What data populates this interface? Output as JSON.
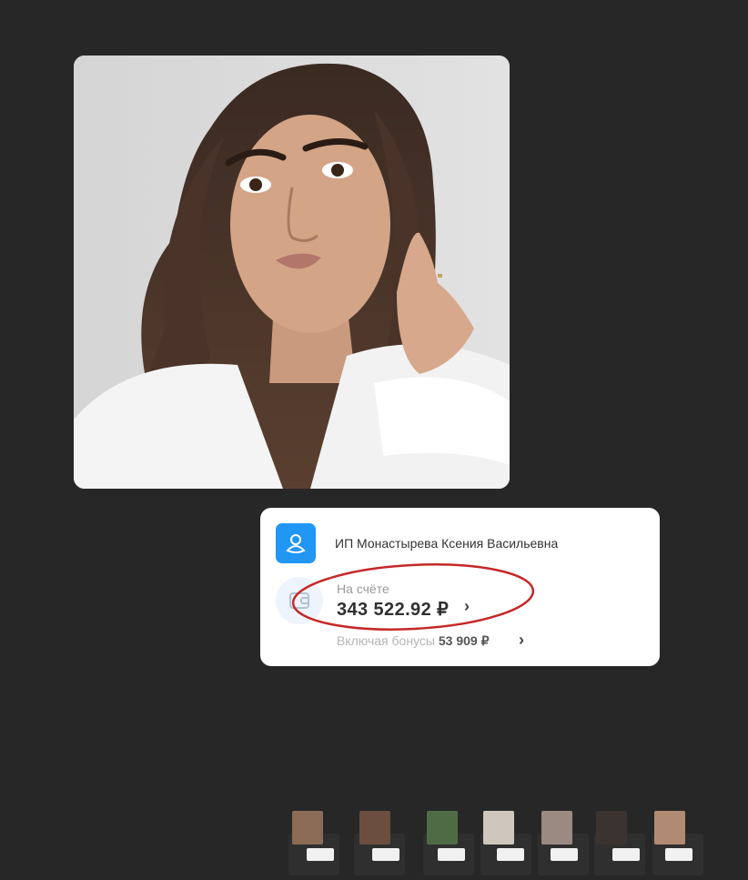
{
  "main_card": {
    "photo_description_icon": "portrait-photo"
  },
  "bank_card": {
    "owner_name": "ИП Монастырева Ксения Васильевна",
    "balance_label": "На счёте",
    "balance_value": "343 522.92 ₽",
    "bonus_prefix": "Включая бонусы",
    "bonus_value": "53 909 ₽",
    "chevron": "›",
    "colors": {
      "accent": "#2196f3",
      "highlight": "#c62828"
    }
  },
  "thumbnails": [
    {
      "icon": "portrait-thumbnail-1"
    },
    {
      "icon": "portrait-thumbnail-2"
    },
    {
      "icon": "portrait-thumbnail-3"
    },
    {
      "icon": "portrait-thumbnail-4"
    },
    {
      "icon": "portrait-thumbnail-5"
    },
    {
      "icon": "portrait-thumbnail-6"
    },
    {
      "icon": "portrait-thumbnail-7"
    }
  ]
}
